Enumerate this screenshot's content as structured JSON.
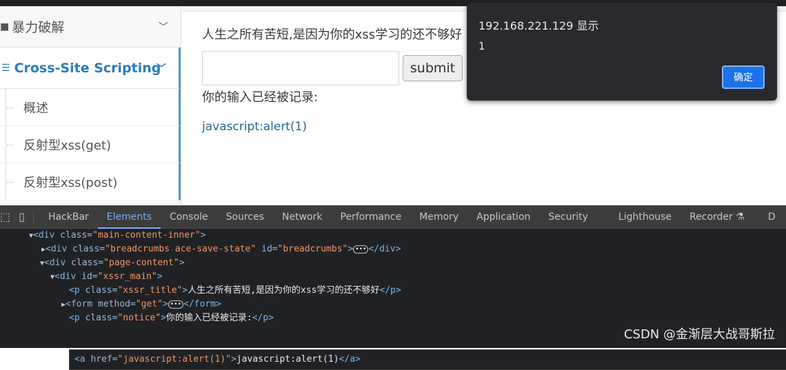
{
  "sidebar": {
    "items": [
      {
        "label": "暴力破解",
        "icon": "lock-icon"
      },
      {
        "label": "Cross-Site Scripting",
        "icon": "list-icon"
      }
    ],
    "subitems": [
      "概述",
      "反射型xss(get)",
      "反射型xss(post)"
    ]
  },
  "main": {
    "title": "人生之所有苦短,是因为你的xss学习的还不够好",
    "input_value": "",
    "submit_label": "submit",
    "notice": "你的输入已经被记录:",
    "link_text": "javascript:alert(1)"
  },
  "dialog": {
    "title": "192.168.221.129 显示",
    "message": "1",
    "ok_label": "确定"
  },
  "devtools": {
    "tabs": [
      "HackBar",
      "Elements",
      "Console",
      "Sources",
      "Network",
      "Performance",
      "Memory",
      "Application",
      "Security",
      "Lighthouse",
      "Recorder",
      "D"
    ],
    "active_tab": "Elements"
  },
  "code": {
    "l1": {
      "tag": "<div ",
      "attr": "class=",
      "val": "\"main-content-inner\"",
      "end": ">"
    },
    "l2": {
      "tag": "<div ",
      "attr": "class=",
      "val": "\"breadcrumbs ace-save-state\"",
      "attr2": " id=",
      "val2": "\"breadcrumbs\"",
      "end": ">",
      "close": "</div>"
    },
    "l3": {
      "tag": "<div ",
      "attr": "class=",
      "val": "\"page-content\"",
      "end": ">"
    },
    "l4": {
      "tag": "<div ",
      "attr": "id=",
      "val": "\"xssr_main\"",
      "end": ">"
    },
    "l5": {
      "tag": "<p ",
      "attr": "class=",
      "val": "\"xssr_title\"",
      "end": ">",
      "text": "人生之所有苦短,是因为你的xss学习的还不够好",
      "close": "</p>"
    },
    "l6": {
      "tag": "<form ",
      "attr": "method=",
      "val": "\"get\"",
      "end": ">",
      "close": "</form>"
    },
    "l7": {
      "tag": "<p ",
      "attr": "class=",
      "val": "\"notice\"",
      "end": ">",
      "text": "你的输入已经被记录:",
      "close": "</p>"
    },
    "l8": {
      "tag": "<a ",
      "attr": "href=",
      "val": "\"javascript:alert(1)\"",
      "end": ">",
      "text": "javascript:alert(1)",
      "close": "</a>"
    }
  },
  "watermark": "CSDN @金渐层大战哥斯拉"
}
